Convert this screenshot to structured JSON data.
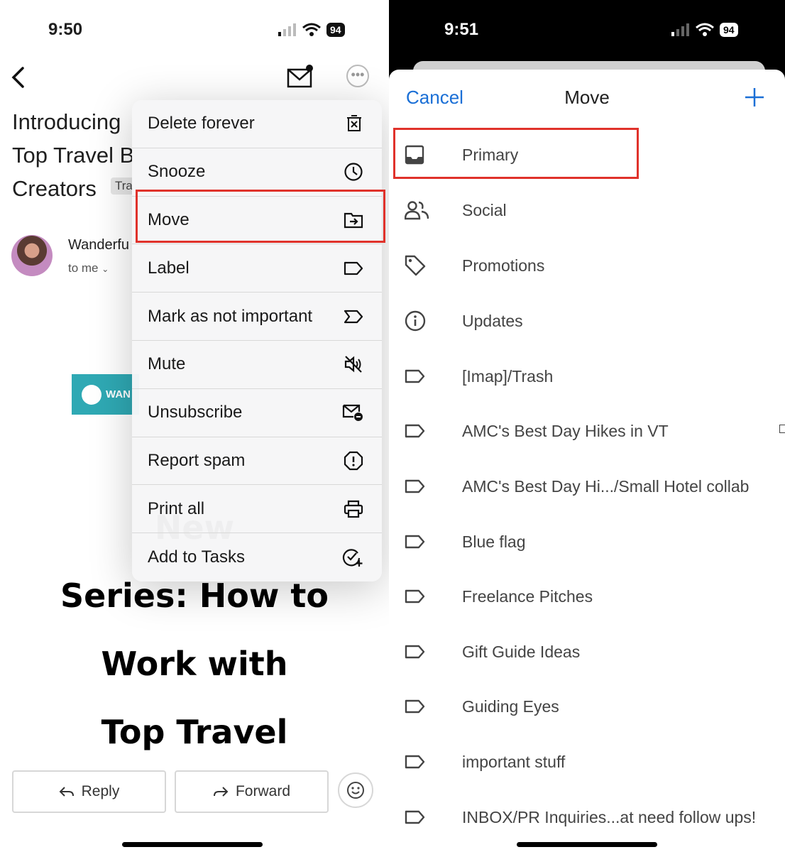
{
  "left_screen": {
    "status": {
      "time": "9:50",
      "battery": "94"
    },
    "subject_lines": [
      "Introducing",
      "Top Travel B",
      "Creators"
    ],
    "tag": "Tra",
    "sender": {
      "name": "Wanderfu",
      "to": "to me"
    },
    "logo_text": "WAN",
    "body_lines": [
      "New",
      "Series: How to",
      "Work with",
      "Top Travel"
    ],
    "menu": [
      {
        "label": "Delete forever",
        "icon": "delete-forever-icon"
      },
      {
        "label": "Snooze",
        "icon": "clock-icon"
      },
      {
        "label": "Move",
        "icon": "move-to-folder-icon"
      },
      {
        "label": "Label",
        "icon": "label-icon"
      },
      {
        "label": "Mark as not important",
        "icon": "not-important-icon"
      },
      {
        "label": "Mute",
        "icon": "mute-icon"
      },
      {
        "label": "Unsubscribe",
        "icon": "unsubscribe-icon"
      },
      {
        "label": "Report spam",
        "icon": "report-spam-icon"
      },
      {
        "label": "Print all",
        "icon": "print-icon"
      },
      {
        "label": "Add to Tasks",
        "icon": "add-task-icon"
      }
    ],
    "actions": {
      "reply": "Reply",
      "forward": "Forward"
    }
  },
  "right_screen": {
    "status": {
      "time": "9:51",
      "battery": "94"
    },
    "header": {
      "cancel": "Cancel",
      "title": "Move"
    },
    "items": [
      {
        "label": "Primary",
        "icon": "inbox-icon"
      },
      {
        "label": "Social",
        "icon": "people-icon"
      },
      {
        "label": "Promotions",
        "icon": "tag-icon"
      },
      {
        "label": "Updates",
        "icon": "info-icon"
      },
      {
        "label": "[Imap]/Trash",
        "icon": "label-icon"
      },
      {
        "label": "AMC's Best Day Hikes in VT",
        "icon": "label-icon"
      },
      {
        "label": "AMC's Best Day Hi.../Small Hotel collab",
        "icon": "label-icon"
      },
      {
        "label": "Blue flag",
        "icon": "label-icon"
      },
      {
        "label": "Freelance Pitches",
        "icon": "label-icon"
      },
      {
        "label": "Gift Guide Ideas",
        "icon": "label-icon"
      },
      {
        "label": "Guiding Eyes",
        "icon": "label-icon"
      },
      {
        "label": "important stuff",
        "icon": "label-icon"
      },
      {
        "label": "INBOX/PR Inquiries...at need follow ups!",
        "icon": "label-icon"
      }
    ]
  }
}
